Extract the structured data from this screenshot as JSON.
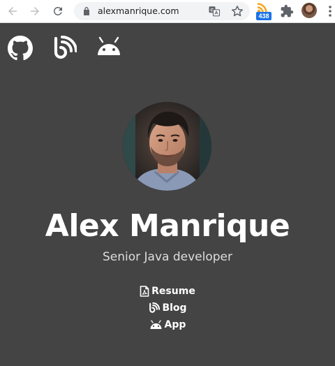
{
  "browser": {
    "url": "alexmanrique.com",
    "extension_badge": "438",
    "colors": {
      "toolbar_bg": "#ffffff",
      "omnibox_bg": "#f1f3f4",
      "icon": "#5f6368",
      "badge_bg": "#1a73e8",
      "rss_orange": "#f5a623"
    },
    "icons": [
      "back-arrow-icon",
      "forward-arrow-icon",
      "reload-icon",
      "lock-icon",
      "translate-icon",
      "star-icon",
      "rss-extension-icon",
      "puzzle-icon",
      "profile-avatar",
      "kebab-menu-icon"
    ]
  },
  "site": {
    "nav_icons": [
      "github-icon",
      "blog-icon",
      "android-icon"
    ],
    "name": "Alex Manrique",
    "role": "Senior Java developer",
    "links": [
      {
        "label": "Resume",
        "icon": "pdf-file-icon"
      },
      {
        "label": "Blog",
        "icon": "blog-icon"
      },
      {
        "label": "App",
        "icon": "android-icon"
      }
    ],
    "colors": {
      "background": "#444444",
      "text": "#ffffff",
      "subtitle": "#dddddd"
    }
  }
}
